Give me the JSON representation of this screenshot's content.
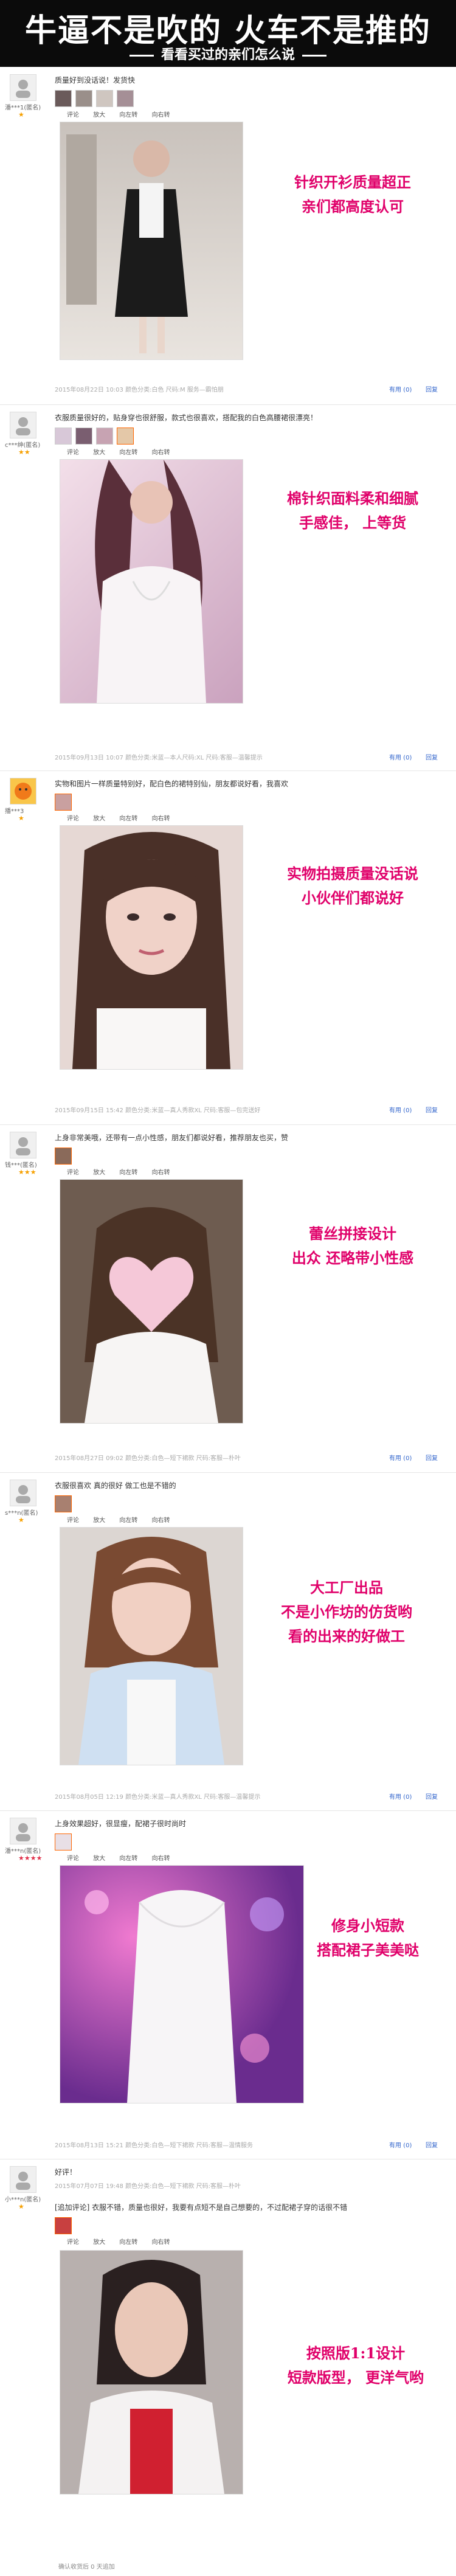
{
  "header": {
    "title": "牛逼不是吹的  火车不是推的",
    "subtitle": "看看买过的亲们怎么说"
  },
  "toolbar": {
    "cmt": "评论",
    "zoom": "放大",
    "rotl": "向左转",
    "rotr": "向右转"
  },
  "common": {
    "useful": "有用 (0)",
    "reply": "回复"
  },
  "reviews": [
    {
      "user": "潘***1(匿名)",
      "rank": "★",
      "text": "质量好到没话说！发货快",
      "caption1": "针织开衫质量超正",
      "caption2": "亲们都高度认可",
      "meta": "2015年08月22日 10:03    颜色分类:白色 尺码:M 服务—霸怕朋"
    },
    {
      "user": "c***绅(匿名)",
      "rank": "★★",
      "text": "衣服质量很好的，贴身穿也很舒服，款式也很喜欢，搭配我的白色高腰裙很漂亮！",
      "caption1": "棉针织面料柔和细腻",
      "caption2": "手感佳， 上等货",
      "meta": "2015年09月13日 10:07    颜色分类:米蓝—本人尺码:XL 尺码:客服—温馨提示"
    },
    {
      "user": "播***3",
      "rank": "★",
      "text": "实物和图片一样质量特别好，配白色的裙特别仙，朋友都说好看，我喜欢",
      "caption1": "实物拍摄质量没话说",
      "caption2": "小伙伴们都说好",
      "meta": "2015年09月15日 15:42    颜色分类:米蓝—真人秀款XL 尺码:客服—包完送好"
    },
    {
      "user": "钱***(匿名)",
      "rank": "★★★",
      "text": "上身非常美哦，还带有一点小性感，朋友们都说好看，推荐朋友也买，赞",
      "caption1": "蕾丝拼接设计",
      "caption2": "出众  还略带小性感",
      "meta": "2015年08月27日 09:02    颜色分类:白色—短下裙款 尺码:客服—朴叶"
    },
    {
      "user": "s***n(匿名)",
      "rank": "★",
      "text": "衣服很喜欢 真的很好 做工也是不错的",
      "caption1": "大工厂出品",
      "caption2": "不是小作坊的仿货哟",
      "caption3": "看的出来的好做工",
      "meta": "2015年08月05日 12:19    颜色分类:米蓝—真人秀款XL 尺码:客服—温馨提示"
    },
    {
      "user": "潘***n(匿名)",
      "rank": "★★★★",
      "text": "上身效果超好，很显瘦，配裙子很时尚时",
      "caption1": "修身小短款",
      "caption2": "搭配裙子美美哒",
      "meta": "2015年08月13日 15:21    颜色分类:白色—短下裙款 尺码:客服—温情服务"
    },
    {
      "user": "小***n(匿名)",
      "rank": "★",
      "text": "好评！",
      "meta_top": "2015年07月07日 19:48    颜色分类:白色—短下裙款 尺码:客服—朴叶",
      "extra": "[追加评论] 衣服不错，质量也很好，我要有点短不是自己想要的，不过配裙子穿的话很不错",
      "caption1": "按照版1:1设计",
      "caption2": "短款版型， 更洋气哟",
      "footer": "确认收货后 0 天追加"
    }
  ]
}
